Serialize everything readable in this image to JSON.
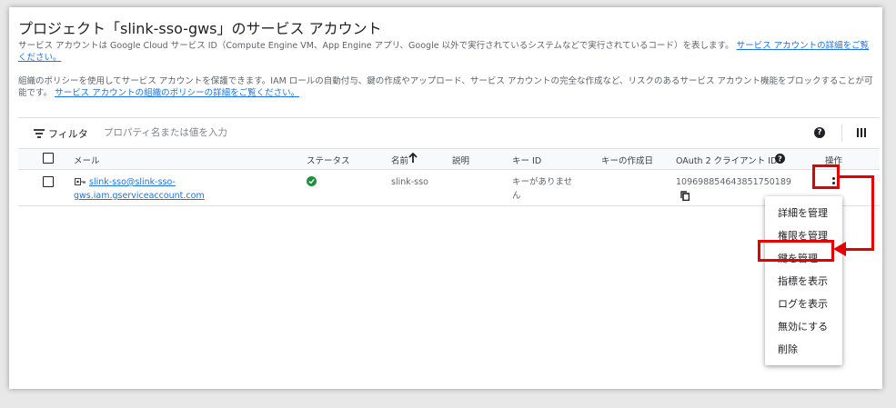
{
  "page": {
    "title": "プロジェクト「slink-sso-gws」のサービス アカウント",
    "description1_text": "サービス アカウントは Google Cloud サービス ID（Compute Engine VM、App Engine アプリ、Google 以外で実行されているシステムなどで実行されているコード）を表します。",
    "description1_link": "サービス アカウントの詳細をご覧ください。",
    "description2_text": "組織のポリシーを使用してサービス アカウントを保護できます。IAM ロールの自動付与、鍵の作成やアップロード、サービス アカウントの完全な作成など、リスクのあるサービス アカウント機能をブロックすることが可能です。",
    "description2_link": "サービス アカウントの組織のポリシーの詳細をご覧ください。"
  },
  "filter": {
    "label": "フィルタ",
    "placeholder": "プロパティ名または値を入力"
  },
  "table": {
    "headers": {
      "email": "メール",
      "status": "ステータス",
      "name": "名前",
      "description": "説明",
      "key_id": "キー ID",
      "key_created": "キーの作成日",
      "oauth_client_id": "OAuth 2 クライアント ID",
      "actions": "操作"
    },
    "rows": [
      {
        "email_line1": "slink-sso@slink-sso-",
        "email_line2": "gws.iam.gserviceaccount.com",
        "status": "enabled",
        "name": "slink-sso",
        "description": "",
        "key_id_line1": "キーがありませ",
        "key_id_line2": "ん",
        "key_created": "",
        "oauth_client_id": "109698854643851750189"
      }
    ]
  },
  "actions_menu": {
    "items": [
      "詳細を管理",
      "権限を管理",
      "鍵を管理",
      "指標を表示",
      "ログを表示",
      "無効にする",
      "削除"
    ],
    "highlighted": "鍵を管理"
  },
  "colors": {
    "accent": "#1a73e8",
    "status_ok": "#1e8e3e",
    "annotation": "#e50000"
  },
  "icons": [
    "filter-icon",
    "help-icon",
    "column-display-icon",
    "sort-arrow-up-icon",
    "service-account-key-icon",
    "check-circle-icon",
    "copy-icon",
    "more-vert-icon",
    "oauth-help-icon"
  ]
}
